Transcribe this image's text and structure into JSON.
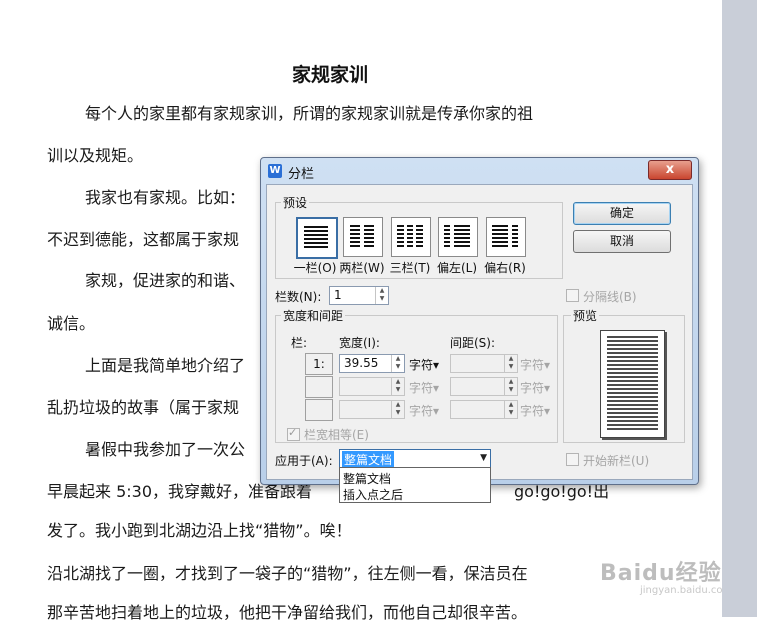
{
  "document": {
    "title": "家规家训",
    "lines": [
      "每个人的家里都有家规家训，所谓的家规家训就是传承你家的祖",
      "训以及规矩。",
      "我家也有家规。比如：",
      "不迟到德能，这都属于家规",
      "家规，促进家的和谐、",
      "诚信。",
      "上面是我简单地介绍了",
      "乱扔垃圾的故事（属于家规",
      "暑假中我参加了一次公",
      "早晨起来 5:30，我穿戴好，准备跟着",
      "go!go!go!出",
      "发了。我小跑到北湖边沿上找“猎物”。唉！",
      "沿北湖找了一圈，才找到了一袋子的“猎物”，往左侧一看，保洁员在",
      "那辛苦地扫着地上的垃圾，他把干净留给我们，而他自己却很辛苦。"
    ],
    "watermark": "Baidu经验",
    "watermark_sub": "jingyan.baidu.com"
  },
  "dialog": {
    "title": "分栏",
    "app_icon": "W",
    "close_label": "x",
    "presets_label": "预设",
    "presets": [
      {
        "label": "一栏(O)",
        "icon": "one-column-icon",
        "selected": true
      },
      {
        "label": "两栏(W)",
        "icon": "two-columns-icon",
        "selected": false
      },
      {
        "label": "三栏(T)",
        "icon": "three-columns-icon",
        "selected": false
      },
      {
        "label": "偏左(L)",
        "icon": "left-column-icon",
        "selected": false
      },
      {
        "label": "偏右(R)",
        "icon": "right-column-icon",
        "selected": false
      }
    ],
    "ok_label": "确定",
    "cancel_label": "取消",
    "columns_label": "栏数(N):",
    "columns_value": "1",
    "separator_label": "分隔线(B)",
    "width_spacing_label": "宽度和间距",
    "col_header": "栏:",
    "width_header": "宽度(I):",
    "spacing_header": "间距(S):",
    "rows": [
      {
        "num": "1:",
        "width": "39.55",
        "width_unit": "字符▾",
        "spacing": "",
        "spacing_unit": "字符▾",
        "enabled": true
      },
      {
        "num": "",
        "width": "",
        "width_unit": "字符▾",
        "spacing": "",
        "spacing_unit": "字符▾",
        "enabled": false
      },
      {
        "num": "",
        "width": "",
        "width_unit": "字符▾",
        "spacing": "",
        "spacing_unit": "字符▾",
        "enabled": false
      }
    ],
    "equal_width_label": "栏宽相等(E)",
    "preview_label": "预览",
    "apply_label": "应用于(A):",
    "apply_value": "整篇文档",
    "apply_options": [
      "整篇文档",
      "插入点之后"
    ],
    "new_column_label": "开始新栏(U)"
  }
}
